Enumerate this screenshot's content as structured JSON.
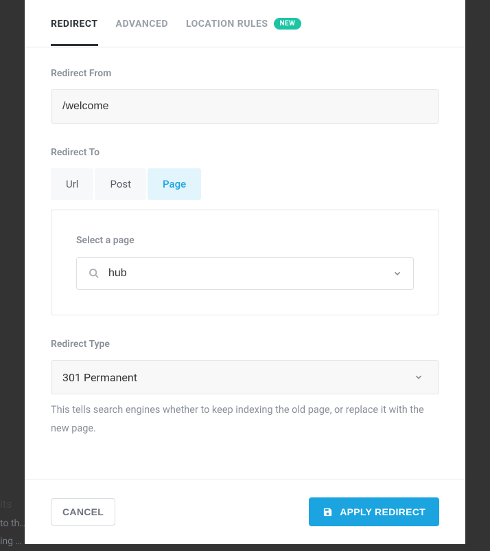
{
  "tabs": [
    {
      "label": "REDIRECT"
    },
    {
      "label": "ADVANCED"
    },
    {
      "label": "LOCATION RULES",
      "badge": "NEW"
    }
  ],
  "from": {
    "label": "Redirect From",
    "value": "/welcome"
  },
  "to": {
    "label": "Redirect To",
    "options": [
      "Url",
      "Post",
      "Page"
    ],
    "active": "Page",
    "pageSelect": {
      "label": "Select a page",
      "value": "hub"
    }
  },
  "type": {
    "label": "Redirect Type",
    "value": "301 Permanent",
    "helper": "This tells search engines whether to keep indexing the old page, or replace it with the new page."
  },
  "footer": {
    "cancel": "CANCEL",
    "apply": "APPLY REDIRECT"
  },
  "bg": {
    "l1": "its",
    "l2": "to th…",
    "l3": "ing …"
  }
}
